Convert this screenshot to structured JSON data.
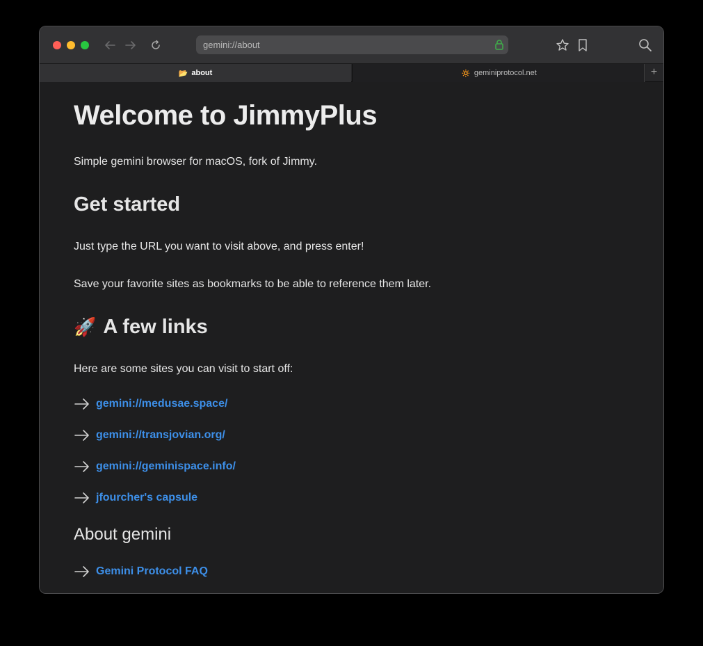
{
  "browser": {
    "url": "gemini://about",
    "tabs": [
      {
        "label": "about",
        "icon": "📂",
        "active": true
      },
      {
        "label": "geminiprotocol.net",
        "icon": "🔅",
        "active": false
      }
    ],
    "new_tab_label": "+"
  },
  "page": {
    "title": "Welcome to JimmyPlus",
    "intro": "Simple gemini browser for macOS, fork of Jimmy.",
    "get_started_heading": "Get started",
    "get_started_p1": "Just type the URL you want to visit above, and press enter!",
    "get_started_p2": "Save your favorite sites as bookmarks to be able to reference them later.",
    "links_heading_icon": "🚀",
    "links_heading": "A few links",
    "links_intro": "Here are some sites you can visit to start off:",
    "links": [
      "gemini://medusae.space/",
      "gemini://transjovian.org/",
      "gemini://geminispace.info/",
      "jfourcher's capsule"
    ],
    "about_heading": "About gemini",
    "about_links": [
      "Gemini Protocol FAQ"
    ]
  },
  "colors": {
    "link": "#3d8fe8",
    "background": "#1e1e1f",
    "lock": "#3fae4a"
  }
}
